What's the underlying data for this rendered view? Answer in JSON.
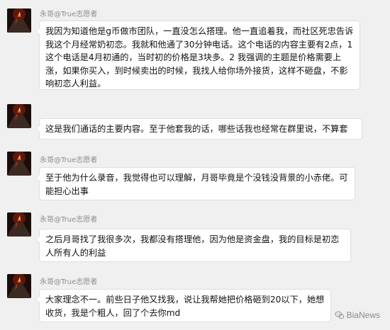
{
  "messages": [
    {
      "sender": "永哥@True志愿者",
      "show_sender": true,
      "text": "我因为知道他是g币做市团队，一直没怎么搭理。他一直追着我，而社区死忠告诉我这个月经常奶初恋。我就和他通了30分钟电话。这个电话的内容主要有2点，1 这个电话是4月初通的，当时初的价格是3块多。2 我强调的主题是价格需要上涨，如果你买入，到时候卖出的时候，我找人给你场外接货，这样不砸盘，不影响初恋人利益。"
    },
    {
      "sender": "",
      "show_sender": false,
      "text": "这是我们通话的主要内容。至于他套我的话，哪些话我也经常在群里说，不算套"
    },
    {
      "sender": "永哥@True志愿者",
      "show_sender": true,
      "text": "至于他为什么录音，我觉得也可以理解，月哥毕竟是个没钱没背景的小赤佬。可能担心出事"
    },
    {
      "sender": "永哥@True志愿者",
      "show_sender": true,
      "text": "之后月哥找了我很多次，我都没有搭理他，因为他是资金盘，我的目标是初恋人所有人的利益"
    },
    {
      "sender": "永哥@True志愿者",
      "show_sender": true,
      "text": "大家理念不一。前些日子他又找我，说让我帮她把价格砸到20以下，她想收货，我是个粗人，回了个去你md"
    }
  ],
  "watermark": {
    "text": "BiaNews",
    "icon": "wechat-icon"
  },
  "colors": {
    "background": "#f0f0f0",
    "bubble": "#ffffff",
    "sender": "#8d8d8d"
  }
}
